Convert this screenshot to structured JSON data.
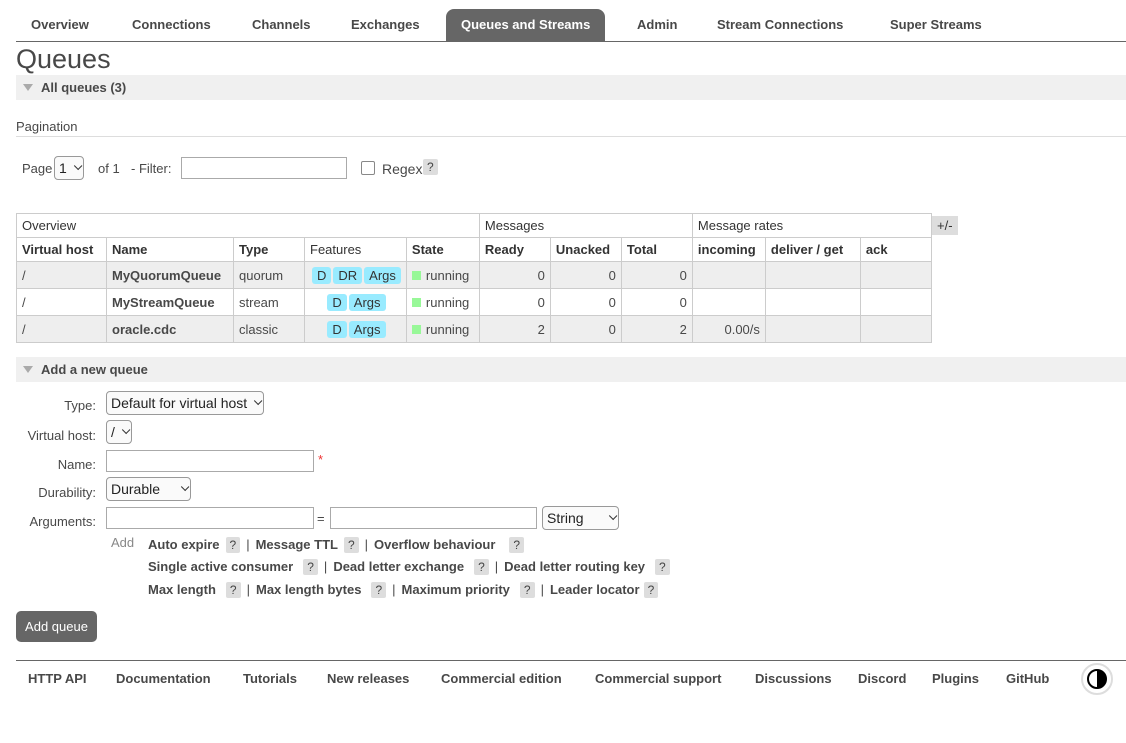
{
  "tabs": [
    "Overview",
    "Connections",
    "Channels",
    "Exchanges",
    "Queues and Streams",
    "Admin",
    "Stream Connections",
    "Super Streams"
  ],
  "page_title": "Queues",
  "all_queues_label": "All queues (3)",
  "pagination": {
    "title": "Pagination",
    "page_label": "Page",
    "page_value": "1",
    "of_label": "of 1",
    "filter_label": "- Filter:",
    "filter_value": "",
    "regex_label": "Regex",
    "help": "?"
  },
  "table": {
    "group_headers": [
      "Overview",
      "Messages",
      "Message rates"
    ],
    "columns": [
      "Virtual host",
      "Name",
      "Type",
      "Features",
      "State",
      "Ready",
      "Unacked",
      "Total",
      "incoming",
      "deliver / get",
      "ack"
    ],
    "plus_minus": "+/-",
    "rows": [
      {
        "vhost": "/",
        "name": "MyQuorumQueue",
        "type": "quorum",
        "features": [
          "D",
          "DR",
          "Args"
        ],
        "state": "running",
        "ready": "0",
        "unacked": "0",
        "total": "0",
        "incoming": "",
        "deliver": "",
        "ack": ""
      },
      {
        "vhost": "/",
        "name": "MyStreamQueue",
        "type": "stream",
        "features": [
          "D",
          "Args"
        ],
        "state": "running",
        "ready": "0",
        "unacked": "0",
        "total": "0",
        "incoming": "",
        "deliver": "",
        "ack": ""
      },
      {
        "vhost": "/",
        "name": "oracle.cdc",
        "type": "classic",
        "features": [
          "D",
          "Args"
        ],
        "state": "running",
        "ready": "2",
        "unacked": "0",
        "total": "2",
        "incoming": "0.00/s",
        "deliver": "",
        "ack": ""
      }
    ]
  },
  "add_queue": {
    "section_label": "Add a new queue",
    "type_label": "Type:",
    "type_value": "Default for virtual host",
    "vhost_label": "Virtual host:",
    "vhost_value": "/",
    "name_label": "Name:",
    "name_value": "",
    "required_mark": "*",
    "durability_label": "Durability:",
    "durability_value": "Durable",
    "arguments_label": "Arguments:",
    "equals": "=",
    "arg_type_value": "String",
    "add_label": "Add",
    "arg_lines": [
      [
        "Auto expire",
        "Message TTL",
        "Overflow behaviour"
      ],
      [
        "Single active consumer",
        "Dead letter exchange",
        "Dead letter routing key"
      ],
      [
        "Max length",
        "Max length bytes",
        "Maximum priority",
        "Leader locator"
      ]
    ],
    "help": "?",
    "separator": "|",
    "button_label": "Add queue"
  },
  "footer": [
    "HTTP API",
    "Documentation",
    "Tutorials",
    "New releases",
    "Commercial edition",
    "Commercial support",
    "Discussions",
    "Discord",
    "Plugins",
    "GitHub"
  ],
  "colors": {
    "accent": "#666666",
    "feature_badge": "#99ebff",
    "running": "#98f898"
  },
  "icons": {
    "theme_toggle": "contrast-icon"
  }
}
